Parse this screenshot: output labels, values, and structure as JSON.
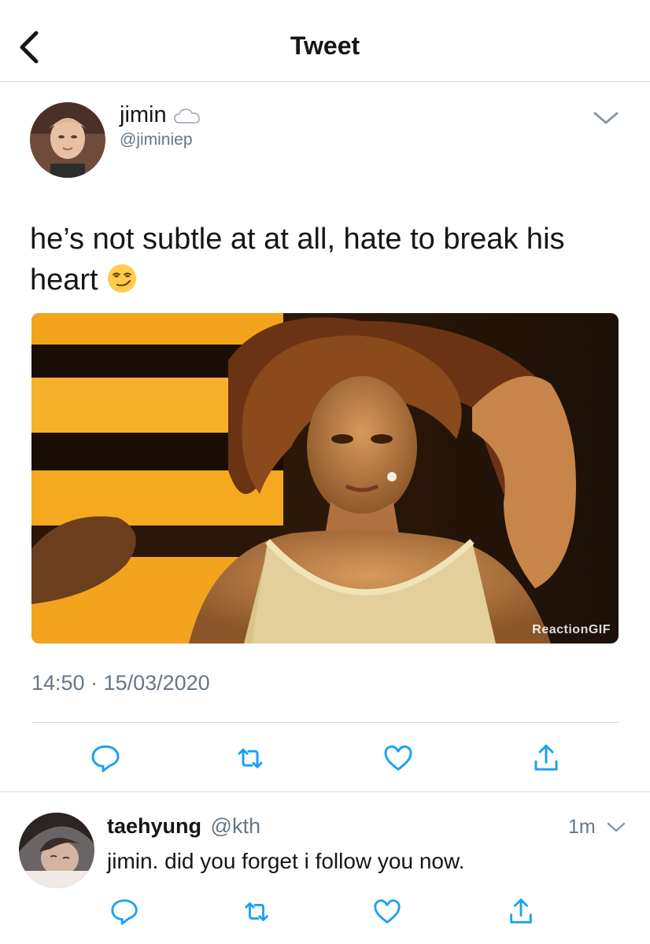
{
  "header": {
    "title": "Tweet",
    "back_icon": "chevron-left-icon"
  },
  "tweet": {
    "author": {
      "name": "jimin",
      "handle": "@jiminiep",
      "badge_icon": "cloud-icon"
    },
    "text": "he’s not subtle at at all, hate to break his heart",
    "emoji": "smirking-face-emoji",
    "media": {
      "watermark": "ReactionGIF"
    },
    "timestamp": "14:50 · 15/03/2020",
    "actions": [
      "reply-icon",
      "retweet-icon",
      "like-icon",
      "share-icon"
    ]
  },
  "reply": {
    "author": {
      "name": "taehyung",
      "handle": "@kth"
    },
    "time": "1m",
    "text": "jimin. did you forget i follow you now.",
    "actions": [
      "reply-icon",
      "retweet-icon",
      "like-icon",
      "share-icon"
    ]
  },
  "colors": {
    "text": "#14171a",
    "secondary": "#657786",
    "divider": "#d6dbe0",
    "icon": "#1da1f2"
  }
}
